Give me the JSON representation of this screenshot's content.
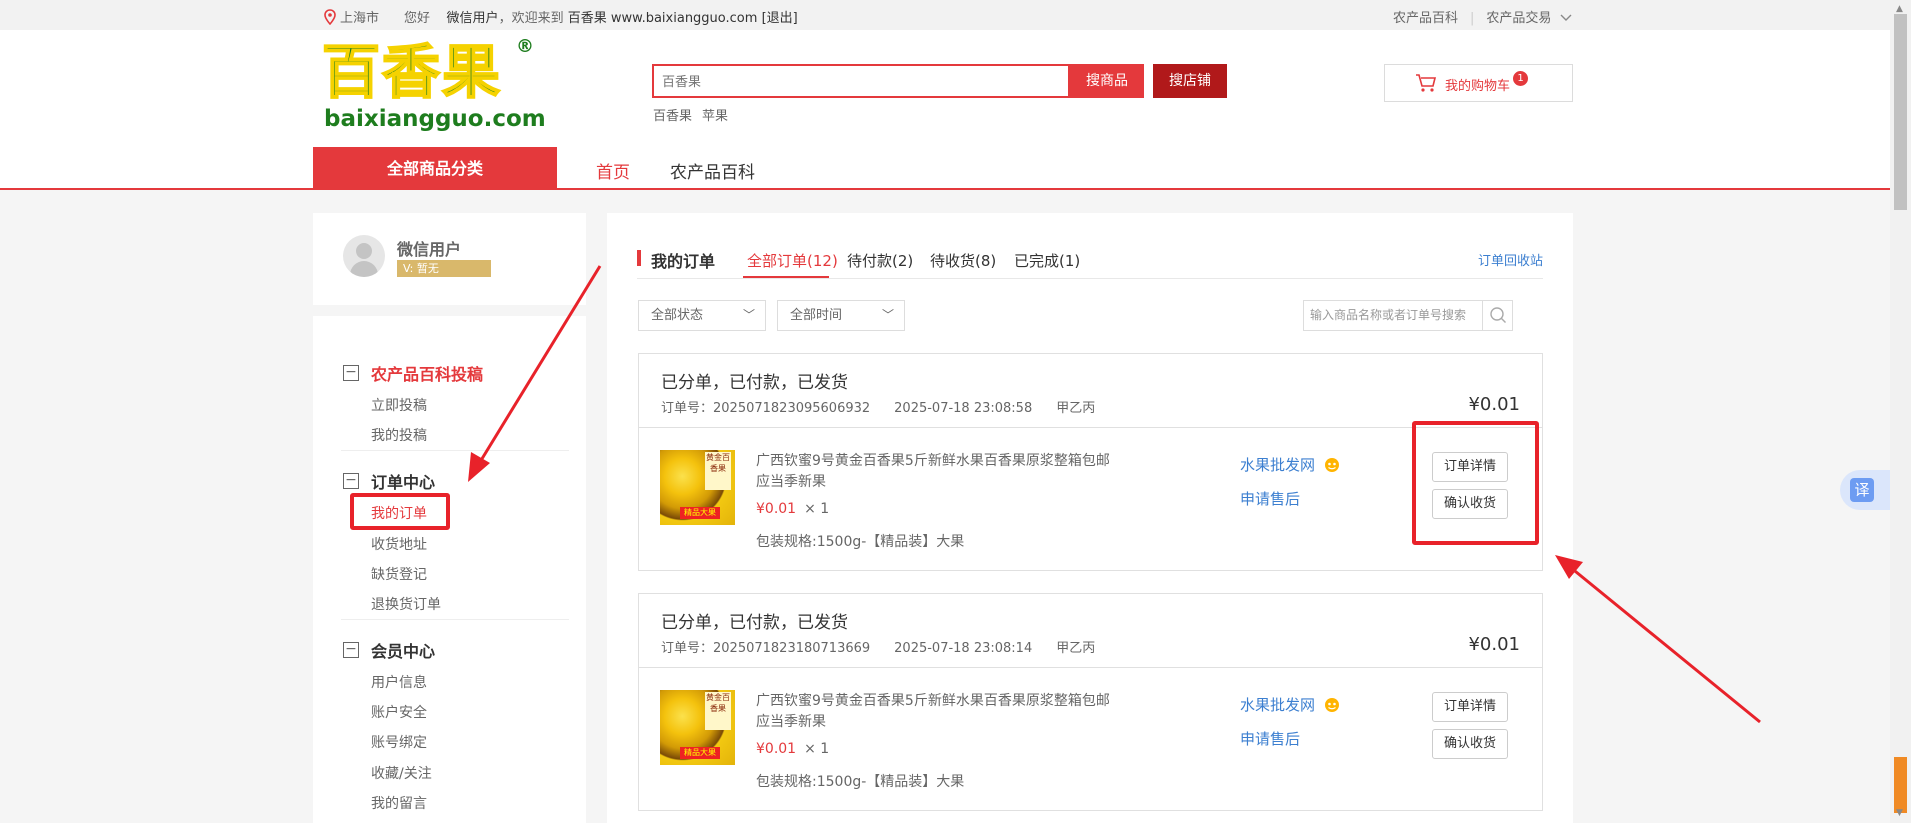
{
  "topbar": {
    "location": "上海市",
    "greeting": "您好",
    "username": "微信用户",
    "welcome": "，欢迎来到",
    "site_name": "百香果",
    "site_url": "www.baixiangguo.com",
    "logout": "[退出]",
    "link_wiki": "农产品百科",
    "link_trade": "农产品交易"
  },
  "header": {
    "logo_cn": "百香果",
    "logo_en": "baixiangguo.com",
    "logo_reg": "®",
    "search_placeholder": "百香果",
    "search_goods_btn": "搜商品",
    "search_shop_btn": "搜店铺",
    "hot_words": [
      "百香果",
      "苹果"
    ],
    "cart_label": "我的购物车",
    "cart_count": "1"
  },
  "nav": {
    "all_categories": "全部商品分类",
    "home": "首页",
    "wiki": "农产品百科"
  },
  "sidebar": {
    "user_name": "微信用户",
    "user_level": "V: 暂无",
    "groups": [
      {
        "title": "农产品百科投稿",
        "items": [
          "立即投稿",
          "我的投稿"
        ]
      },
      {
        "title": "订单中心",
        "items": [
          "我的订单",
          "收货地址",
          "缺货登记",
          "退换货订单"
        ]
      },
      {
        "title": "会员中心",
        "items": [
          "用户信息",
          "账户安全",
          "账号绑定",
          "收藏/关注",
          "我的留言"
        ]
      }
    ]
  },
  "orders_page": {
    "title": "我的订单",
    "tabs": [
      "全部订单(12)",
      "待付款(2)",
      "待收货(8)",
      "已完成(1)"
    ],
    "recycle": "订单回收站",
    "filter_status": "全部状态",
    "filter_time": "全部时间",
    "search_placeholder": "输入商品名称或者订单号搜索"
  },
  "orders": [
    {
      "status": "已分单，已付款，已发货",
      "order_no": "订单号：2025071823095606932",
      "time": "2025-07-18 23:08:58",
      "receiver": "甲乙丙",
      "total": "¥0.01",
      "product_name": "广西钦蜜9号黄金百香果5斤新鲜水果百香果原浆整箱包邮应当季新果",
      "price": "¥0.01",
      "qty": "× 1",
      "spec": "包装规格:1500g-【精品装】大果",
      "shop": "水果批发网",
      "after_sale": "申请售后",
      "btn_detail": "订单详情",
      "btn_confirm": "确认收货"
    },
    {
      "status": "已分单，已付款，已发货",
      "order_no": "订单号：2025071823180713669",
      "time": "2025-07-18 23:08:14",
      "receiver": "甲乙丙",
      "total": "¥0.01",
      "product_name": "广西钦蜜9号黄金百香果5斤新鲜水果百香果原浆整箱包邮应当季新果",
      "price": "¥0.01",
      "qty": "× 1",
      "spec": "包装规格:1500g-【精品装】大果",
      "shop": "水果批发网",
      "after_sale": "申请售后",
      "btn_detail": "订单详情",
      "btn_confirm": "确认收货"
    }
  ],
  "product_image_text": {
    "sticker": "黄金百香果",
    "tag": "精品大果"
  },
  "translate_label": "译",
  "colors": {
    "brand_red": "#e4393c",
    "link_blue": "#3c7fd0",
    "annotation_red": "#e8222a"
  }
}
